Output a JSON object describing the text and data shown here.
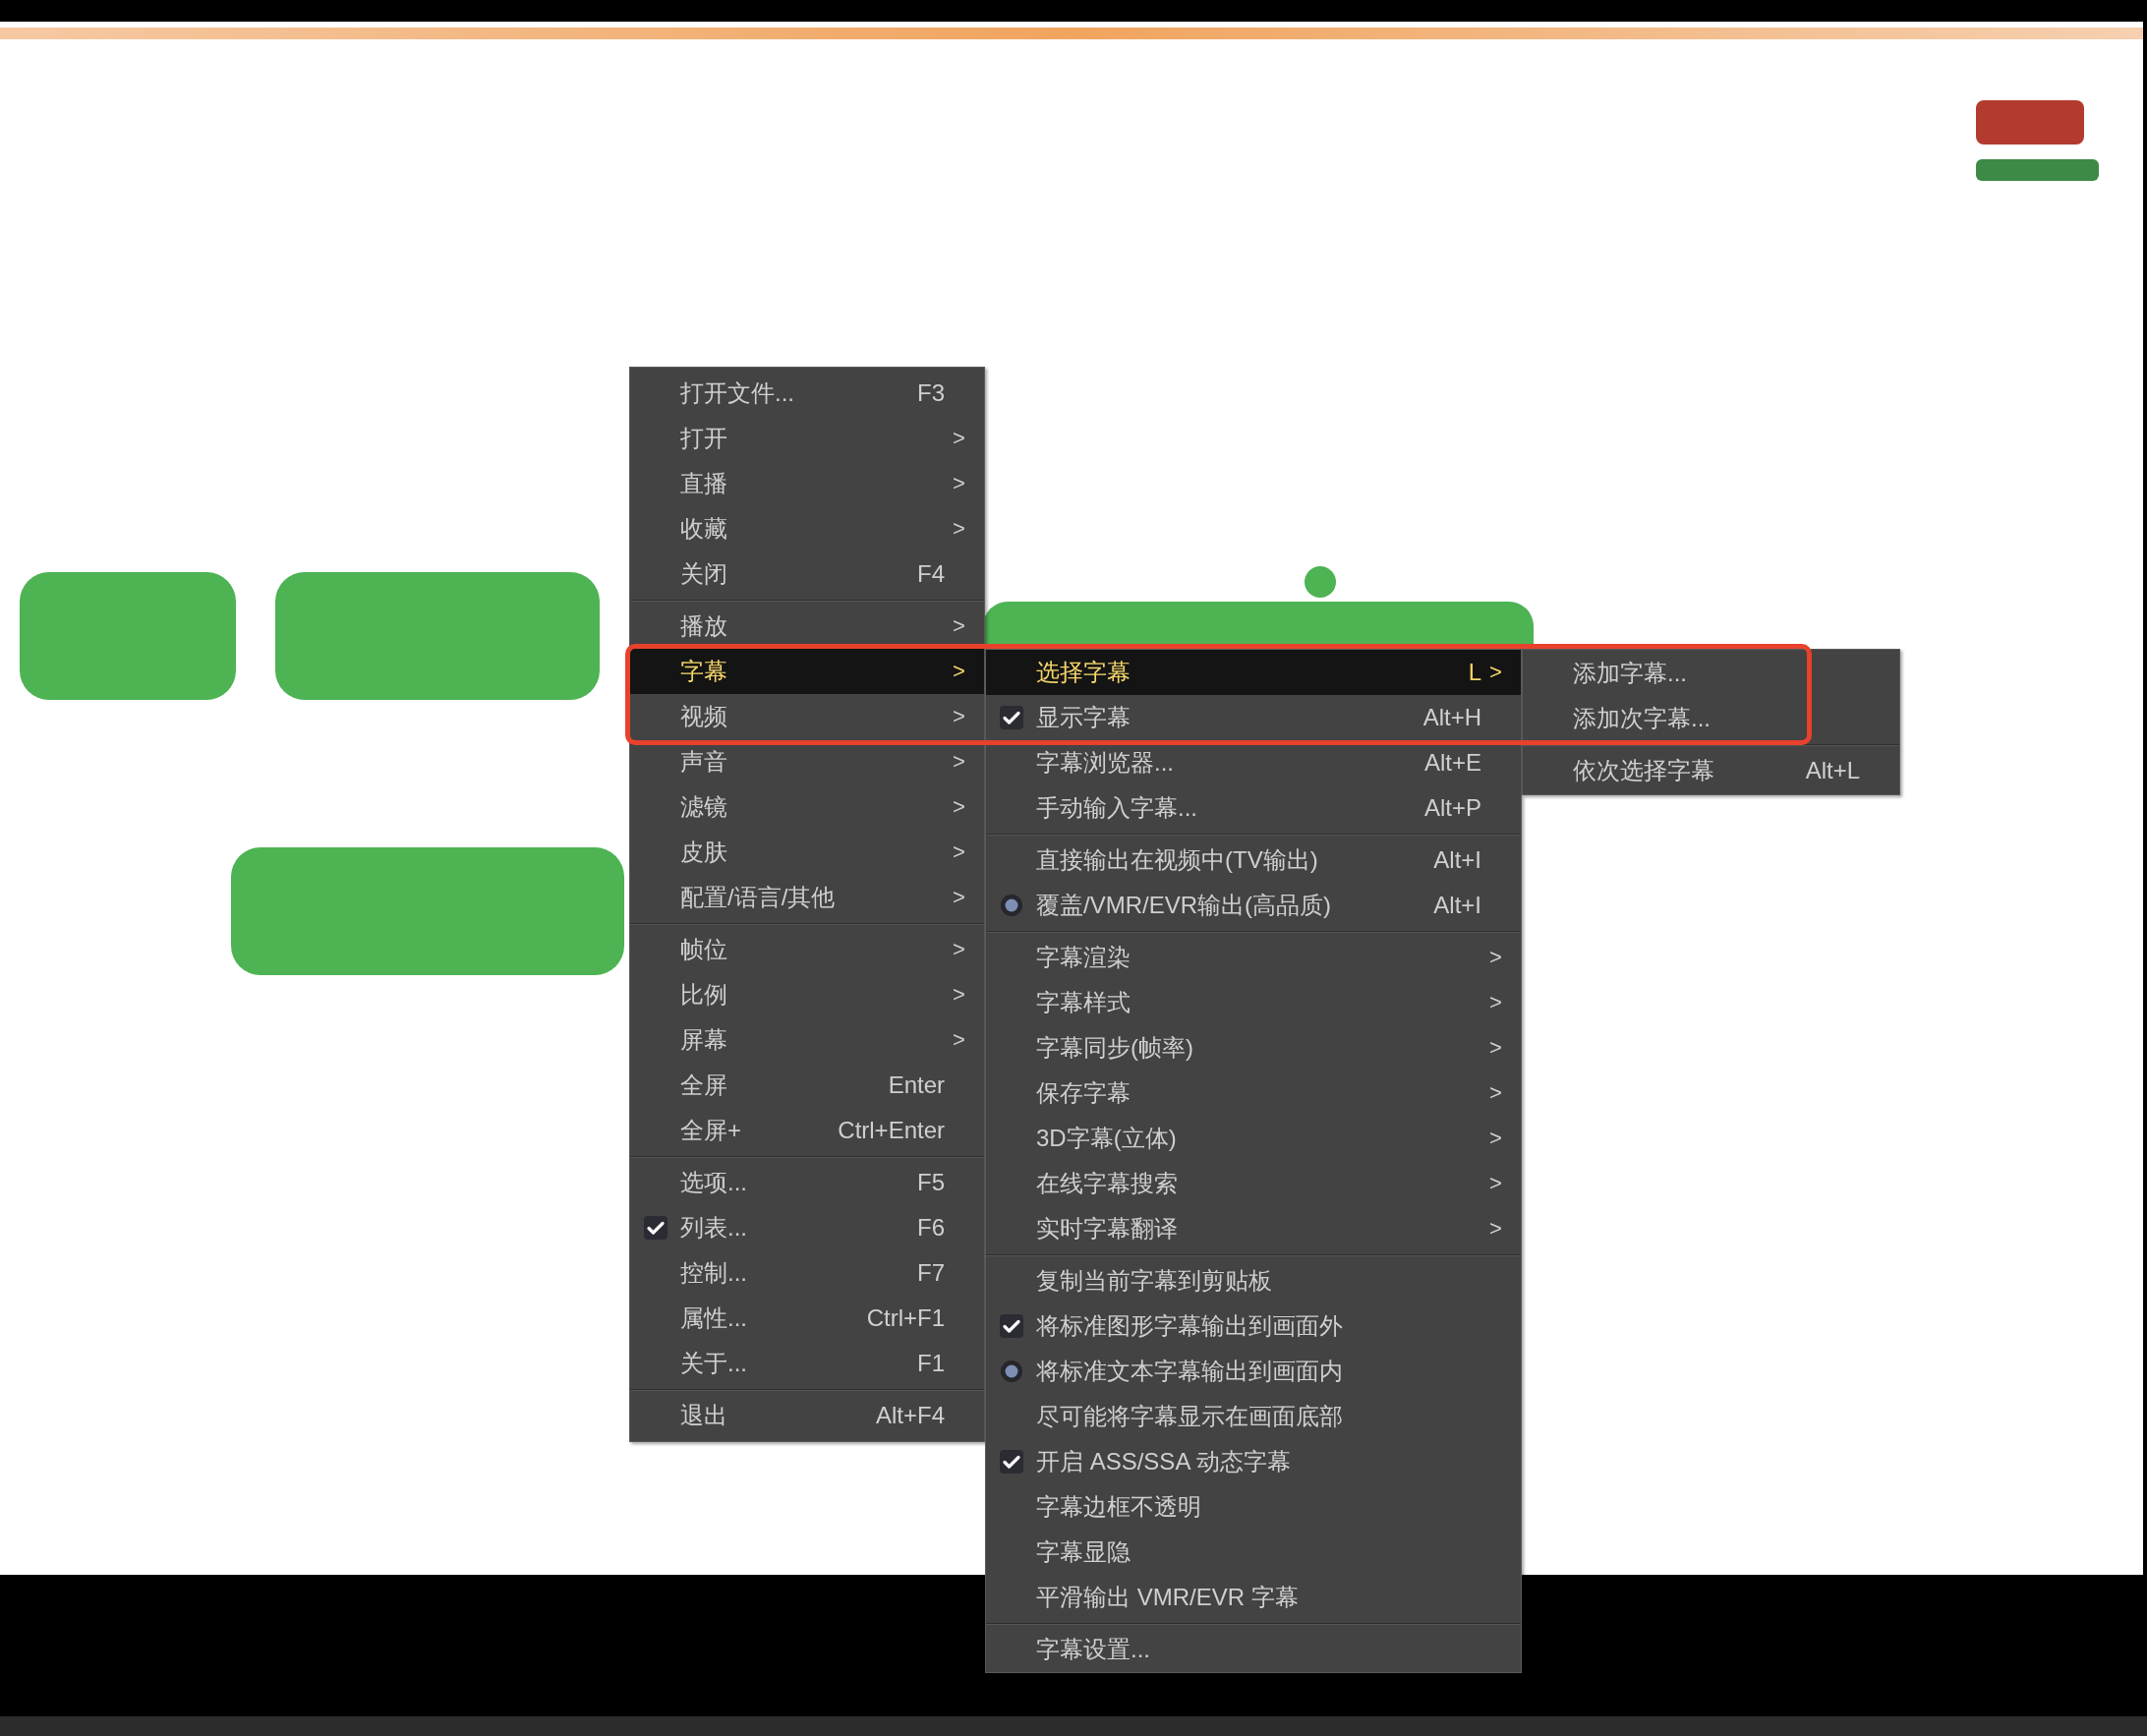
{
  "menus": [
    {
      "items": [
        {
          "kind": "item",
          "label": "打开文件...",
          "shortcut": "F3",
          "checked": false,
          "selected": false
        },
        {
          "kind": "item",
          "label": "打开",
          "arrow": ">",
          "checked": false,
          "selected": false
        },
        {
          "kind": "item",
          "label": "直播",
          "arrow": ">",
          "checked": false,
          "selected": false
        },
        {
          "kind": "item",
          "label": "收藏",
          "arrow": ">",
          "checked": false,
          "selected": false
        },
        {
          "kind": "item",
          "label": "关闭",
          "shortcut": "F4",
          "checked": false,
          "selected": false
        },
        {
          "kind": "separator"
        },
        {
          "kind": "item",
          "label": "播放",
          "arrow": ">",
          "checked": false,
          "selected": false
        },
        {
          "kind": "item",
          "label": "字幕",
          "arrow": ">",
          "checked": false,
          "selected": true
        },
        {
          "kind": "item",
          "label": "视频",
          "arrow": ">",
          "checked": false,
          "selected": false
        },
        {
          "kind": "item",
          "label": "声音",
          "arrow": ">",
          "checked": false,
          "selected": false
        },
        {
          "kind": "item",
          "label": "滤镜",
          "arrow": ">",
          "checked": false,
          "selected": false
        },
        {
          "kind": "item",
          "label": "皮肤",
          "arrow": ">",
          "checked": false,
          "selected": false
        },
        {
          "kind": "item",
          "label": "配置/语言/其他",
          "arrow": ">",
          "checked": false,
          "selected": false
        },
        {
          "kind": "separator"
        },
        {
          "kind": "item",
          "label": "帧位",
          "arrow": ">",
          "checked": false,
          "selected": false
        },
        {
          "kind": "item",
          "label": "比例",
          "arrow": ">",
          "checked": false,
          "selected": false
        },
        {
          "kind": "item",
          "label": "屏幕",
          "arrow": ">",
          "checked": false,
          "selected": false
        },
        {
          "kind": "item",
          "label": "全屏",
          "shortcut": "Enter",
          "checked": false,
          "selected": false
        },
        {
          "kind": "item",
          "label": "全屏+",
          "shortcut": "Ctrl+Enter",
          "checked": false,
          "selected": false
        },
        {
          "kind": "separator"
        },
        {
          "kind": "item",
          "label": "选项...",
          "shortcut": "F5",
          "checked": false,
          "selected": false
        },
        {
          "kind": "item",
          "label": "列表...",
          "shortcut": "F6",
          "checked": true,
          "selected": false
        },
        {
          "kind": "item",
          "label": "控制...",
          "shortcut": "F7",
          "checked": false,
          "selected": false
        },
        {
          "kind": "item",
          "label": "属性...",
          "shortcut": "Ctrl+F1",
          "checked": false,
          "selected": false
        },
        {
          "kind": "item",
          "label": "关于...",
          "shortcut": "F1",
          "checked": false,
          "selected": false
        },
        {
          "kind": "separator"
        },
        {
          "kind": "item",
          "label": "退出",
          "shortcut": "Alt+F4",
          "checked": false,
          "selected": false
        }
      ]
    },
    {
      "items": [
        {
          "kind": "item",
          "label": "选择字幕",
          "shortcut": "L",
          "arrow": ">",
          "checked": false,
          "selected": true
        },
        {
          "kind": "item",
          "label": "显示字幕",
          "shortcut": "Alt+H",
          "checked": true,
          "selected": false
        },
        {
          "kind": "item",
          "label": "字幕浏览器...",
          "shortcut": "Alt+E",
          "checked": false,
          "selected": false
        },
        {
          "kind": "item",
          "label": "手动输入字幕...",
          "shortcut": "Alt+P",
          "checked": false,
          "selected": false
        },
        {
          "kind": "separator"
        },
        {
          "kind": "radio",
          "label": "直接输出在视频中(TV输出)",
          "shortcut": "Alt+I",
          "checked": false,
          "selected": false
        },
        {
          "kind": "radio",
          "label": "覆盖/VMR/EVR输出(高品质)",
          "shortcut": "Alt+I",
          "checked": true,
          "selected": false
        },
        {
          "kind": "separator"
        },
        {
          "kind": "item",
          "label": "字幕渲染",
          "arrow": ">",
          "checked": false,
          "selected": false
        },
        {
          "kind": "item",
          "label": "字幕样式",
          "arrow": ">",
          "checked": false,
          "selected": false
        },
        {
          "kind": "item",
          "label": "字幕同步(帧率)",
          "arrow": ">",
          "checked": false,
          "selected": false
        },
        {
          "kind": "item",
          "label": "保存字幕",
          "arrow": ">",
          "checked": false,
          "selected": false
        },
        {
          "kind": "item",
          "label": "3D字幕(立体)",
          "arrow": ">",
          "checked": false,
          "selected": false
        },
        {
          "kind": "item",
          "label": "在线字幕搜索",
          "arrow": ">",
          "checked": false,
          "selected": false
        },
        {
          "kind": "item",
          "label": "实时字幕翻译",
          "arrow": ">",
          "checked": false,
          "selected": false
        },
        {
          "kind": "separator"
        },
        {
          "kind": "item",
          "label": "复制当前字幕到剪贴板",
          "checked": false,
          "selected": false
        },
        {
          "kind": "item",
          "label": "将标准图形字幕输出到画面外",
          "checked": true,
          "selected": false
        },
        {
          "kind": "radio",
          "label": "将标准文本字幕输出到画面内",
          "checked": true,
          "selected": false
        },
        {
          "kind": "item",
          "label": "尽可能将字幕显示在画面底部",
          "checked": false,
          "selected": false
        },
        {
          "kind": "item",
          "label": "开启 ASS/SSA 动态字幕",
          "checked": true,
          "selected": false
        },
        {
          "kind": "item",
          "label": "字幕边框不透明",
          "checked": false,
          "selected": false
        },
        {
          "kind": "item",
          "label": "字幕显隐",
          "checked": false,
          "selected": false
        },
        {
          "kind": "item",
          "label": "平滑输出 VMR/EVR 字幕",
          "checked": false,
          "selected": false
        },
        {
          "kind": "separator"
        },
        {
          "kind": "item",
          "label": "字幕设置...",
          "checked": false,
          "selected": false
        }
      ]
    },
    {
      "items": [
        {
          "kind": "item",
          "label": "添加字幕...",
          "checked": false,
          "selected": false
        },
        {
          "kind": "item",
          "label": "添加次字幕...",
          "checked": false,
          "selected": false
        },
        {
          "kind": "separator"
        },
        {
          "kind": "item",
          "label": "依次选择字幕",
          "shortcut": "Alt+L",
          "checked": false,
          "selected": false
        }
      ]
    }
  ]
}
